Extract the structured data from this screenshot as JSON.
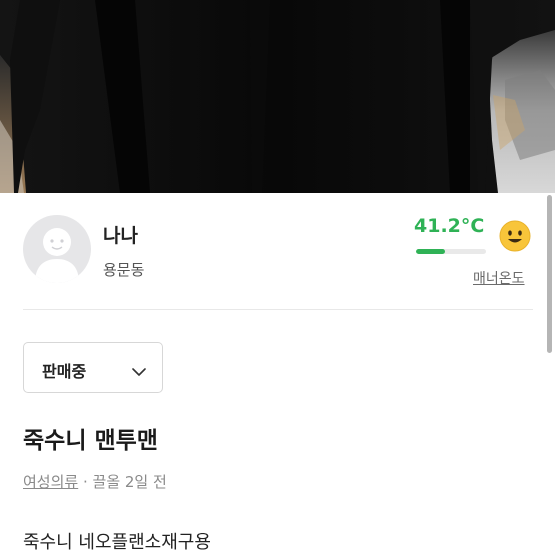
{
  "seller": {
    "name": "나나",
    "location": "용문동",
    "manner_temperature": "41.2°C",
    "manner_temperature_level": 0.41,
    "manner_link": "매너온도",
    "avatar_icon": "default-avatar-icon",
    "emoji_icon": "smile-emoji-icon"
  },
  "status_dropdown": {
    "selected": "판매중"
  },
  "post": {
    "title": "죽수니 맨투맨",
    "category": "여성의류",
    "separator": " · ",
    "time": "끌올 2일 전",
    "description": "죽수니 네오플랜소재구용"
  },
  "colors": {
    "accent": "#2fb256",
    "text": "#222222",
    "muted": "#8a8a8a"
  }
}
